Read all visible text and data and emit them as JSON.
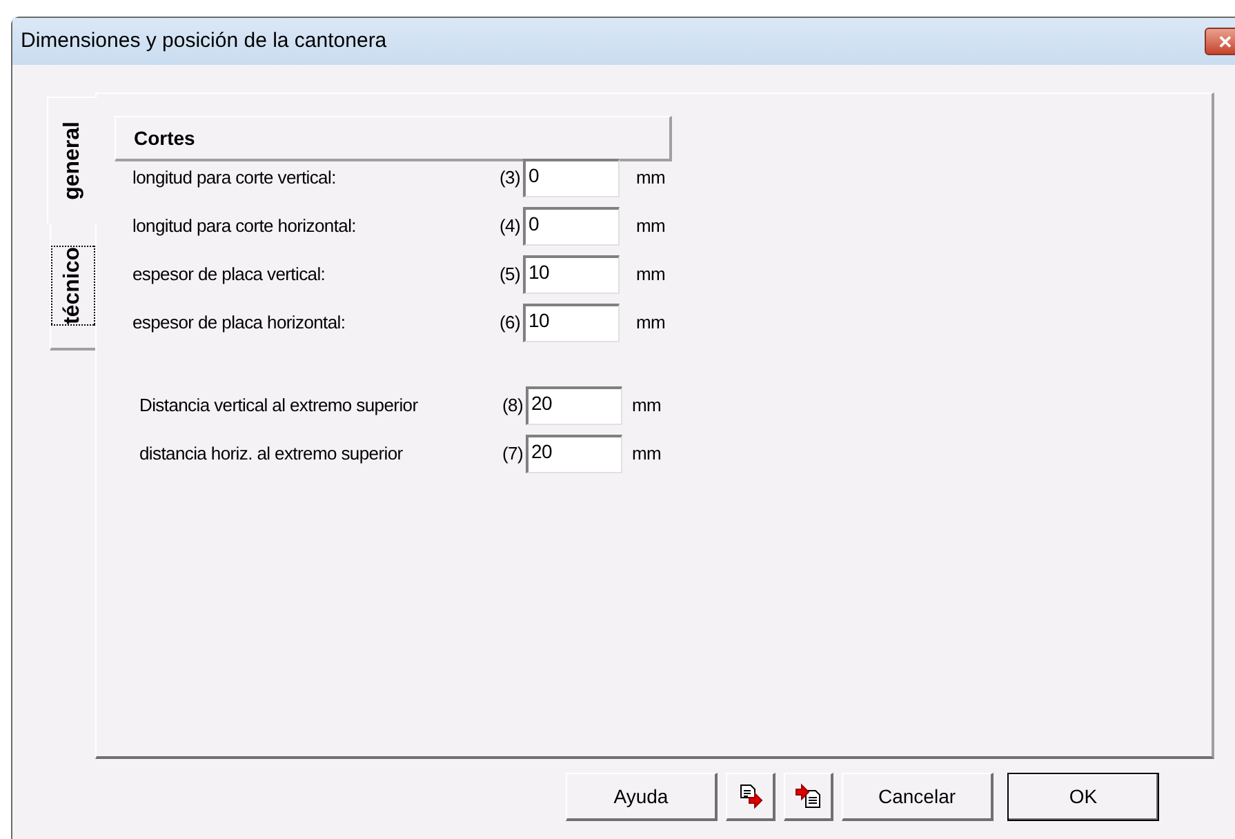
{
  "window": {
    "title": "Dimensiones y posición de la cantonera",
    "close": "✕"
  },
  "tabs": [
    {
      "label": "general",
      "selected": true
    },
    {
      "label": "técnico",
      "selected": false
    }
  ],
  "section": {
    "title": "Cortes"
  },
  "groups": [
    {
      "rows": [
        {
          "label": "longitud para corte vertical:",
          "number": "(3)",
          "value": "0",
          "unit": "mm"
        },
        {
          "label": "longitud para corte horizontal:",
          "number": "(4)",
          "value": "0",
          "unit": "mm"
        },
        {
          "label": "espesor de placa vertical:",
          "number": "(5)",
          "value": "10",
          "unit": "mm"
        },
        {
          "label": "espesor de placa horizontal:",
          "number": "(6)",
          "value": "10",
          "unit": "mm"
        }
      ]
    },
    {
      "rows": [
        {
          "label": "Distancia vertical al extremo superior",
          "number": "(8)",
          "value": "20",
          "unit": "mm"
        },
        {
          "label": "distancia horiz. al extremo superior",
          "number": "(7)",
          "value": "20",
          "unit": "mm"
        }
      ]
    }
  ],
  "buttons": [
    {
      "kind": "text",
      "label": "Ayuda",
      "default": false
    },
    {
      "kind": "export",
      "default": false
    },
    {
      "kind": "import",
      "default": false
    },
    {
      "kind": "text",
      "label": "Cancelar",
      "default": false
    },
    {
      "kind": "text",
      "label": "OK",
      "default": true
    }
  ]
}
